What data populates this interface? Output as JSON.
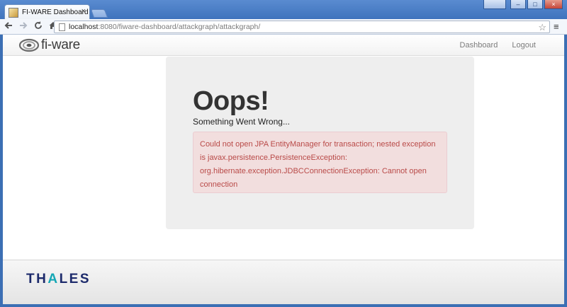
{
  "browser": {
    "tab_title": "FI-WARE Dashboard",
    "tab_close": "×",
    "url_host": "localhost",
    "url_rest": ":8080/fiware-dashboard/attackgraph/attackgraph/",
    "icons": {
      "back": "back-arrow-icon",
      "forward": "forward-arrow-icon",
      "reload": "reload-icon",
      "home": "home-icon",
      "star": "star-icon",
      "menu": "menu-icon"
    }
  },
  "navbar": {
    "brand": "fi-ware",
    "links": [
      "Dashboard",
      "Logout"
    ]
  },
  "error": {
    "heading": "Oops!",
    "subtitle": "Something Went Wrong...",
    "message": "Could not open JPA EntityManager for transaction; nested exception is javax.persistence.PersistenceException: org.hibernate.exception.JDBCConnectionException: Cannot open connection"
  },
  "footer": {
    "logo_text": "THALES"
  },
  "colors": {
    "alert_bg": "#f2dede",
    "alert_text": "#b94a48",
    "panel_bg": "#eeeeee",
    "thales_blue": "#1c2a6b",
    "thales_teal": "#14a7b5"
  }
}
